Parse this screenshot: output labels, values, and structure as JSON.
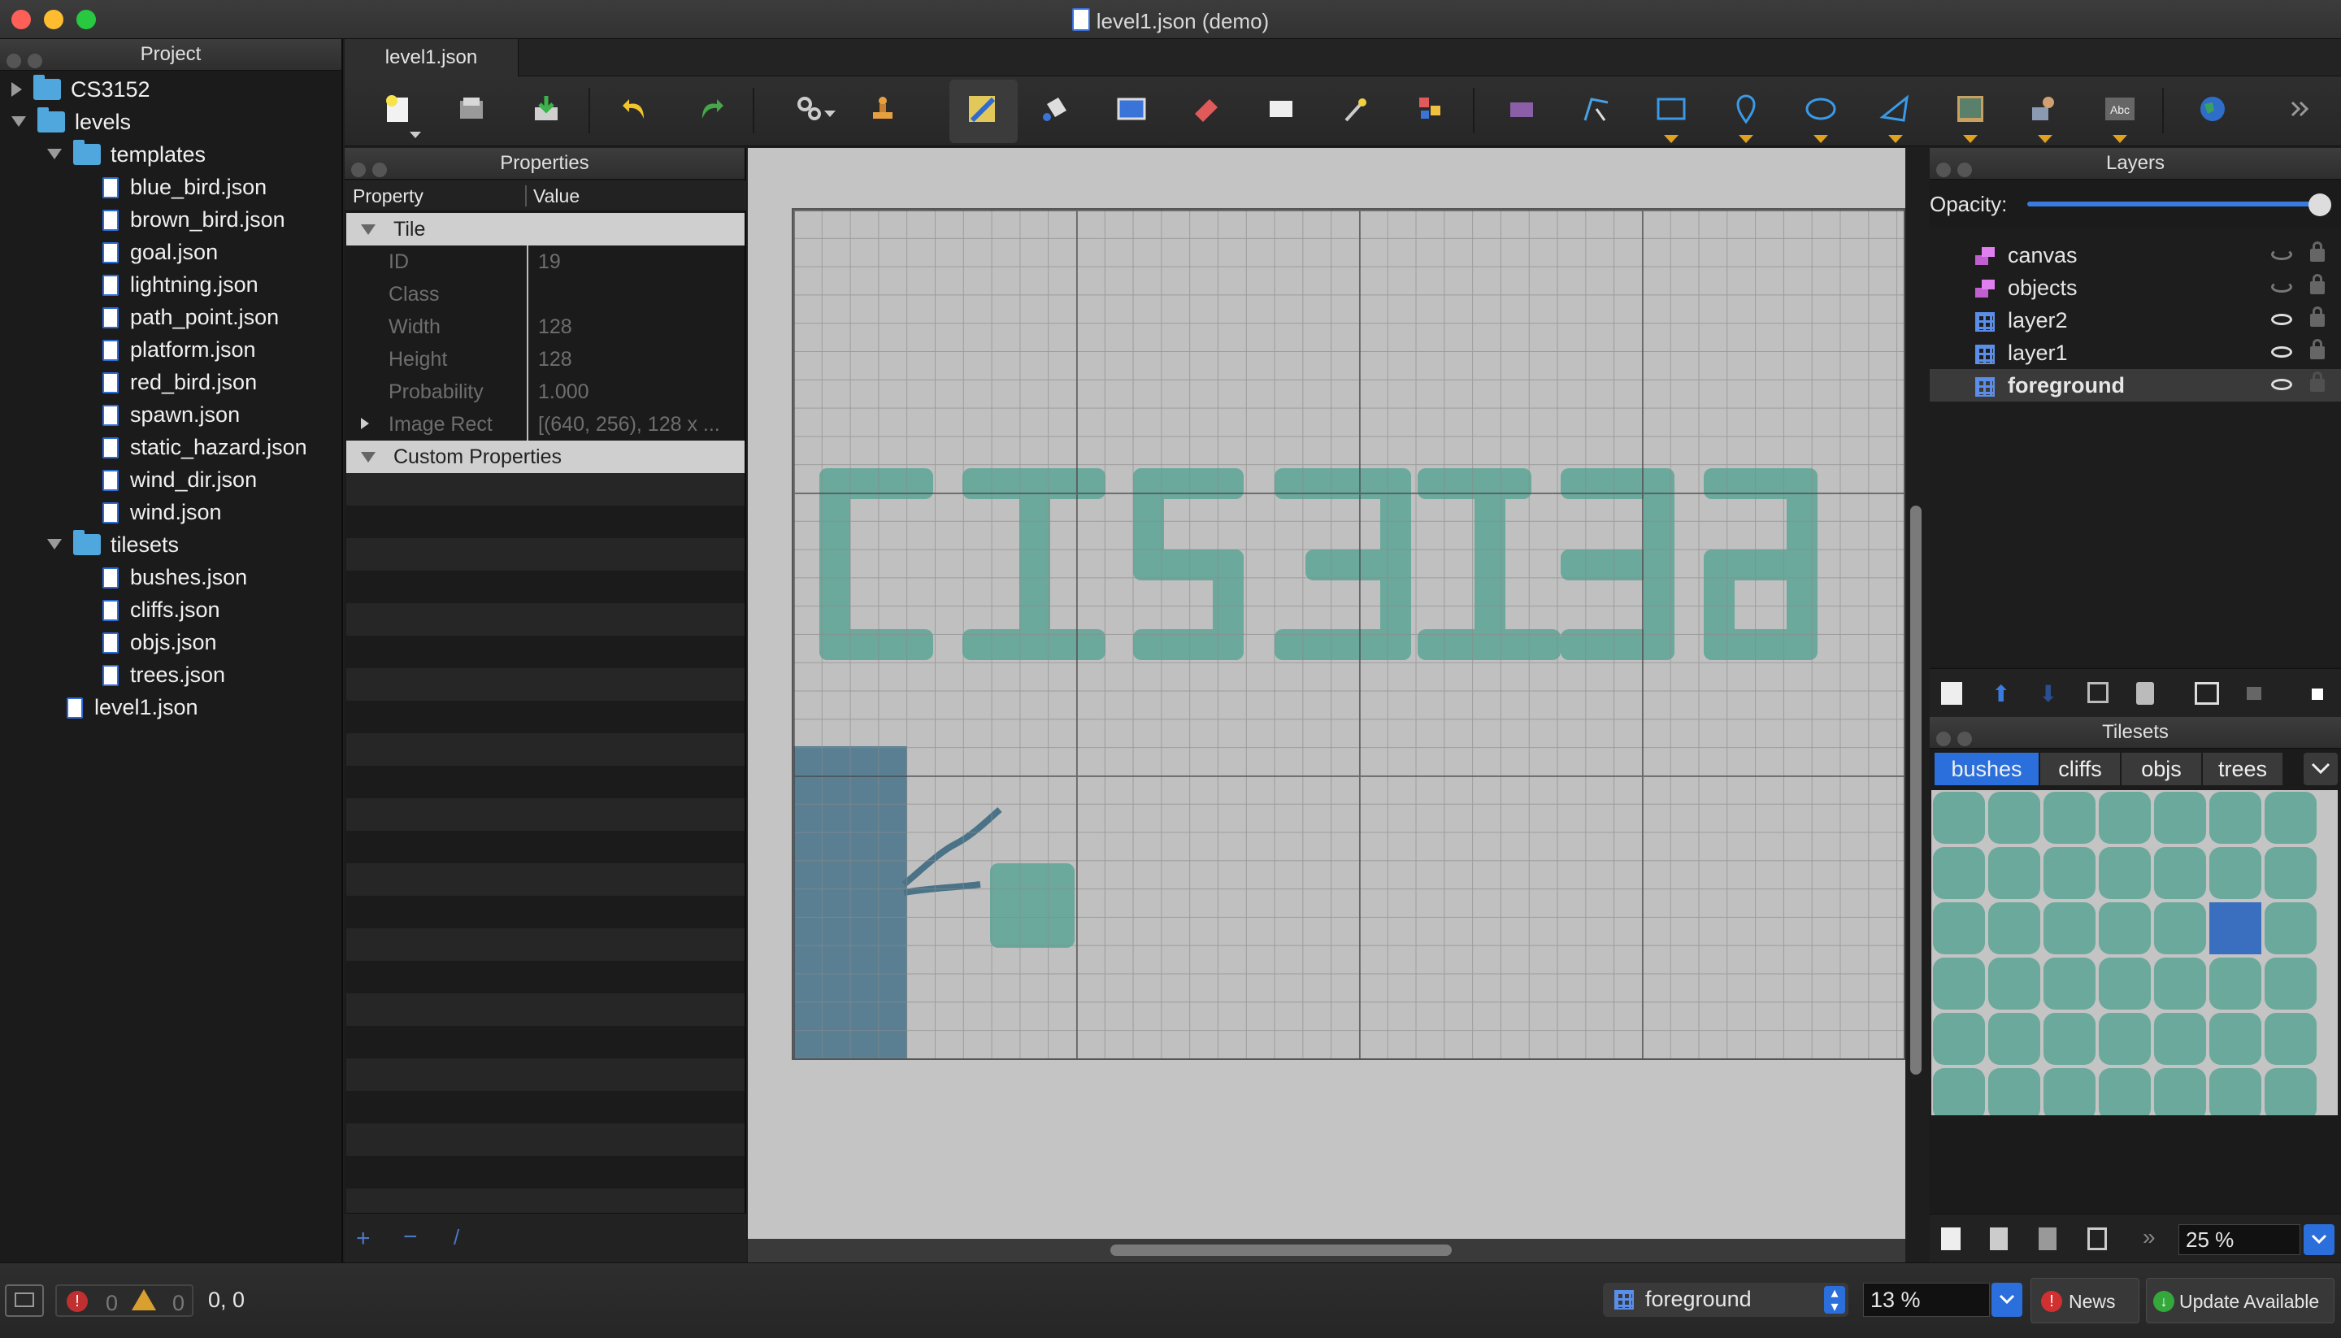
{
  "window": {
    "title": "level1.json (demo)"
  },
  "project": {
    "header": "Project",
    "tree": [
      {
        "label": "CS3152",
        "kind": "folder",
        "depth": 0,
        "twisty": "right"
      },
      {
        "label": "levels",
        "kind": "folder",
        "depth": 0,
        "twisty": "down"
      },
      {
        "label": "templates",
        "kind": "folder",
        "depth": 1,
        "twisty": "down"
      },
      {
        "label": "blue_bird.json",
        "kind": "file",
        "depth": 2
      },
      {
        "label": "brown_bird.json",
        "kind": "file",
        "depth": 2
      },
      {
        "label": "goal.json",
        "kind": "file",
        "depth": 2
      },
      {
        "label": "lightning.json",
        "kind": "file",
        "depth": 2
      },
      {
        "label": "path_point.json",
        "kind": "file",
        "depth": 2
      },
      {
        "label": "platform.json",
        "kind": "file",
        "depth": 2
      },
      {
        "label": "red_bird.json",
        "kind": "file",
        "depth": 2
      },
      {
        "label": "spawn.json",
        "kind": "file",
        "depth": 2
      },
      {
        "label": "static_hazard.json",
        "kind": "file",
        "depth": 2
      },
      {
        "label": "wind_dir.json",
        "kind": "file",
        "depth": 2
      },
      {
        "label": "wind.json",
        "kind": "file",
        "depth": 2
      },
      {
        "label": "tilesets",
        "kind": "folder",
        "depth": 1,
        "twisty": "down"
      },
      {
        "label": "bushes.json",
        "kind": "file",
        "depth": 2
      },
      {
        "label": "cliffs.json",
        "kind": "file",
        "depth": 2
      },
      {
        "label": "objs.json",
        "kind": "file",
        "depth": 2
      },
      {
        "label": "trees.json",
        "kind": "file",
        "depth": 2
      },
      {
        "label": "level1.json",
        "kind": "file",
        "depth": 1
      }
    ]
  },
  "tabs": [
    {
      "label": "level1.json"
    }
  ],
  "toolbar": {
    "icons": [
      "new-map-icon",
      "open-icon",
      "save-icon",
      "undo-icon",
      "redo-icon",
      "command-icon",
      "stamp-brush-icon",
      "terrain-brush-icon",
      "bucket-fill-icon",
      "shape-fill-icon",
      "eraser-icon",
      "rectangle-select-icon",
      "magic-wand-icon",
      "select-same-tile-icon",
      "select-objects-icon",
      "edit-polygons-icon",
      "insert-rectangle-icon",
      "insert-point-icon",
      "insert-ellipse-icon",
      "insert-polygon-icon",
      "insert-tile-icon",
      "insert-template-icon",
      "insert-text-icon",
      "world-tool-icon",
      "more-icon"
    ]
  },
  "properties": {
    "header": "Properties",
    "col_property": "Property",
    "col_value": "Value",
    "group_tile": "Tile",
    "rows": [
      {
        "key": "ID",
        "value": "19"
      },
      {
        "key": "Class",
        "value": ""
      },
      {
        "key": "Width",
        "value": "128"
      },
      {
        "key": "Height",
        "value": "128"
      },
      {
        "key": "Probability",
        "value": "1.000"
      },
      {
        "key": "Image Rect",
        "value": "[(640, 256), 128 x ..."
      }
    ],
    "group_custom": "Custom Properties"
  },
  "map": {
    "text_layer": "CIS3152"
  },
  "layers": {
    "header": "Layers",
    "opacity_label": "Opacity:",
    "opacity": 1.0,
    "items": [
      {
        "name": "canvas",
        "type": "object",
        "visible": false,
        "locked": true,
        "selected": false
      },
      {
        "name": "objects",
        "type": "object",
        "visible": false,
        "locked": true,
        "selected": false
      },
      {
        "name": "layer2",
        "type": "tile",
        "visible": true,
        "locked": true,
        "selected": false
      },
      {
        "name": "layer1",
        "type": "tile",
        "visible": true,
        "locked": true,
        "selected": false
      },
      {
        "name": "foreground",
        "type": "tile",
        "visible": true,
        "locked": false,
        "selected": true
      }
    ]
  },
  "tilesets": {
    "header": "Tilesets",
    "tabs": [
      {
        "label": "bushes",
        "active": true
      },
      {
        "label": "cliffs",
        "active": false
      },
      {
        "label": "objs",
        "active": false
      },
      {
        "label": "trees",
        "active": false
      }
    ],
    "zoom": "25 %"
  },
  "status": {
    "errors": "0",
    "warnings": "0",
    "coords": "0, 0",
    "layer_select": "foreground",
    "zoom": "13 %",
    "news_label": "News",
    "update_label": "Update Available"
  },
  "colors": {
    "accent": "#2a6fdb",
    "bush": "#6aa99c",
    "cliff": "#5a7f93",
    "selected_tile": "#3a6fc0"
  }
}
